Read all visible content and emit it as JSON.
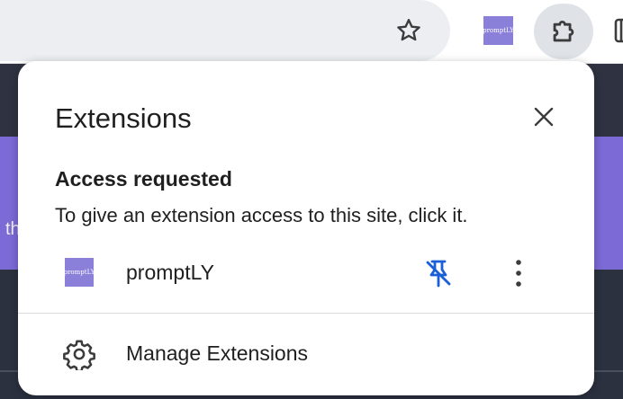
{
  "toolbar": {
    "bookmark_icon": "star-icon",
    "pinned_extension": {
      "icon_text": "promptLY",
      "color": "#8a80d9"
    },
    "extensions_icon": "puzzle-icon"
  },
  "page": {
    "banner_text": "th",
    "banner_color": "#7c6ad6"
  },
  "popup": {
    "title": "Extensions",
    "close_icon": "close-icon",
    "section": {
      "heading": "Access requested",
      "description": "To give an extension access to this site, click it."
    },
    "extensions": [
      {
        "name": "promptLY",
        "icon_text": "promptLY",
        "pin_icon": "pin-off-icon",
        "menu_icon": "more-vert-icon"
      }
    ],
    "manage": {
      "label": "Manage Extensions",
      "icon": "gear-icon"
    }
  }
}
